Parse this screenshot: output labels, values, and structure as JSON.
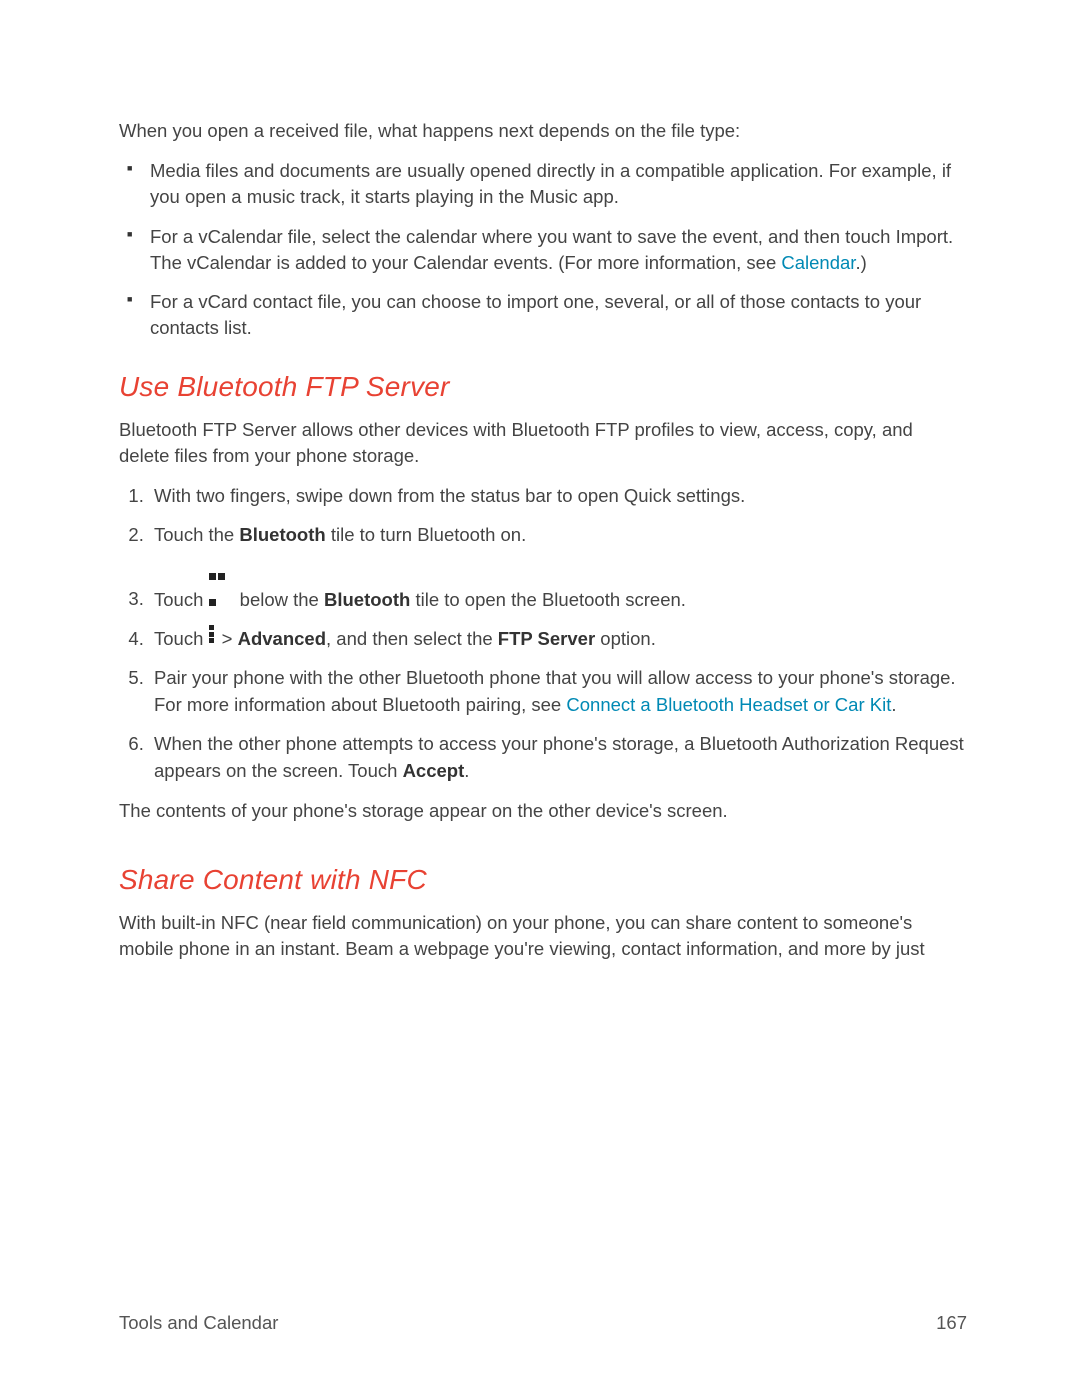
{
  "intro": "When you open a received file, what happens next depends on the file type:",
  "bullets": [
    {
      "text": "Media files and documents are usually opened directly in a compatible application. For example, if you open a music track, it starts playing in the Music app."
    },
    {
      "pre": "For a vCalendar file, select the calendar where you want to save the event, and then touch Import. The vCalendar is added to your Calendar events. (For more information, see ",
      "link": "Calendar",
      "post": ".)"
    },
    {
      "text": "For a vCard contact file, you can choose to import one, several, or all of those contacts to your contacts list."
    }
  ],
  "section1": {
    "title": "Use Bluetooth FTP Server",
    "desc": "Bluetooth FTP Server allows other devices with Bluetooth FTP profiles to view, access, copy, and delete files from your phone storage.",
    "steps": {
      "s1": "With two fingers, swipe down from the status bar to open Quick settings.",
      "s2_pre": "Touch the ",
      "s2_b": "Bluetooth",
      "s2_post": " tile to turn Bluetooth on.",
      "s3_pre": "Touch ",
      "s3_mid": " below the ",
      "s3_b": "Bluetooth",
      "s3_post": " tile to open the Bluetooth screen.",
      "s4_pre": "Touch ",
      "s4_gt": " > ",
      "s4_b1": "Advanced",
      "s4_mid": ", and then select the ",
      "s4_b2": "FTP Server",
      "s4_post": " option.",
      "s5_pre": "Pair your phone with the other Bluetooth phone that you will allow access to your phone's storage. For more information about Bluetooth pairing, see ",
      "s5_link": "Connect a Bluetooth Headset or Car Kit",
      "s5_post": ".",
      "s6_pre": "When the other phone attempts to access your phone's storage, a Bluetooth Authorization Request appears on the screen. Touch ",
      "s6_b": "Accept",
      "s6_post": "."
    },
    "closing": "The contents of your phone's storage appear on the other device's screen."
  },
  "section2": {
    "title": "Share Content with NFC",
    "desc": "With built-in NFC (near field communication) on your phone, you can share content to someone's mobile phone in an instant. Beam a webpage you're viewing, contact information, and more by just"
  },
  "footer": {
    "section": "Tools and Calendar",
    "page": "167"
  }
}
